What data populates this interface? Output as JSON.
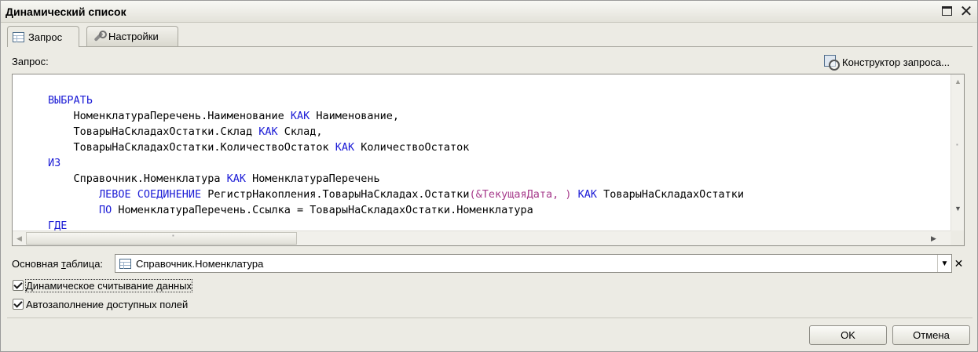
{
  "window": {
    "title": "Динамический список"
  },
  "tabs": [
    {
      "label": "Запрос",
      "icon": "table-icon",
      "active": true
    },
    {
      "label": "Настройки",
      "icon": "wrench-icon",
      "active": false
    }
  ],
  "query": {
    "label": "Запрос:",
    "constructor_label": "Конструктор запроса...",
    "lines": [
      "ВЫБРАТЬ",
      "    НоменклатураПеречень.Наименование КАК Наименование,",
      "    ТоварыНаСкладахОстатки.Склад КАК Склад,",
      "    ТоварыНаСкладахОстатки.КоличествоОстаток КАК КоличествоОстаток",
      "ИЗ",
      "    Справочник.Номенклатура КАК НоменклатураПеречень",
      "        ЛЕВОЕ СОЕДИНЕНИЕ РегистрНакопления.ТоварыНаСкладах.Остатки(&ТекущаяДата, ) КАК ТоварыНаСкладахОстатки",
      "        ПО НоменклатураПеречень.Ссылка = ТоварыНаСкладахОстатки.Номенклатура",
      "ГДЕ"
    ]
  },
  "main_table": {
    "label": "Основная таблица:",
    "value": "Справочник.Номенклатура"
  },
  "options": [
    {
      "label": "Динамическое считывание данных",
      "checked": true
    },
    {
      "label": "Автозаполнение доступных полей",
      "checked": true
    }
  ],
  "buttons": {
    "ok": "OK",
    "cancel": "Отмена"
  },
  "colors": {
    "keyword": "#1c1cd6",
    "parameter": "#a73c8c",
    "window_bg": "#ecebe4"
  }
}
